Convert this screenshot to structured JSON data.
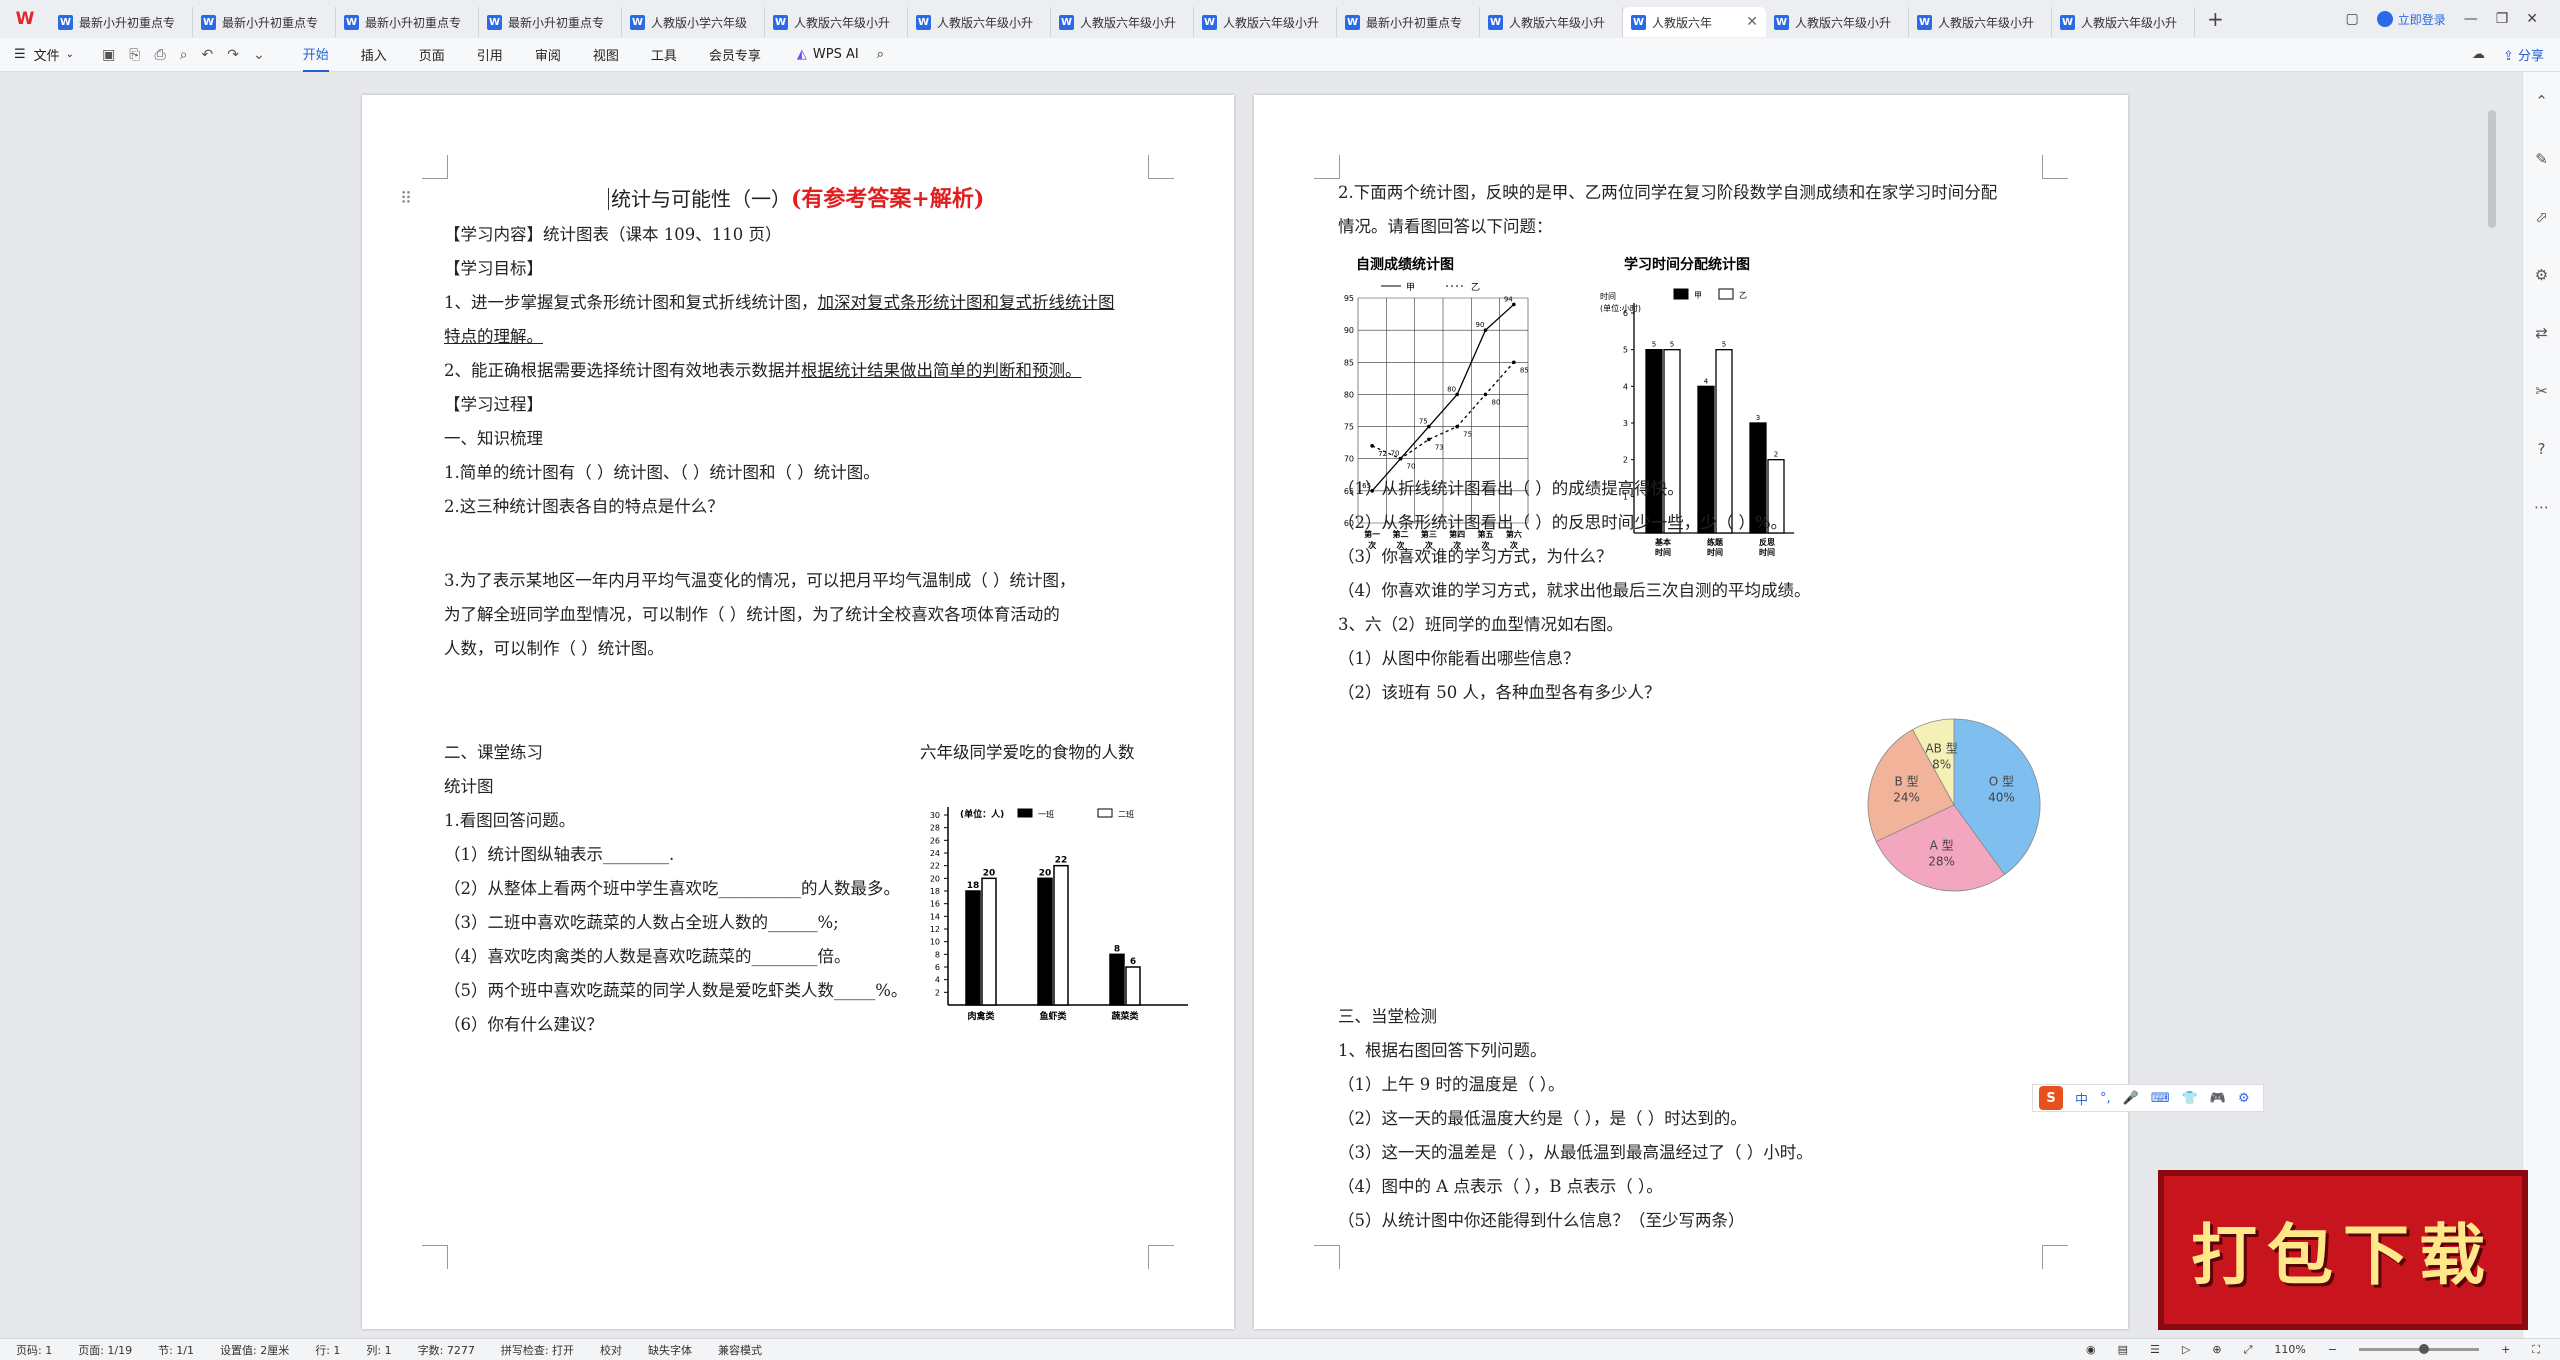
{
  "app": {
    "logo": "W"
  },
  "tabs": [
    "最新小升初重点专",
    "最新小升初重点专",
    "最新小升初重点专",
    "最新小升初重点专",
    "人教版小学六年级",
    "人教版六年级小升",
    "人教版六年级小升",
    "人教版六年级小升",
    "人教版六年级小升",
    "最新小升初重点专",
    "人教版六年级小升",
    "人教版六年",
    "人教版六年级小升",
    "人教版六年级小升",
    "人教版六年级小升"
  ],
  "title_bar": {
    "login": "立即登录",
    "share": "分享"
  },
  "toolbar": {
    "file": "文件",
    "menus": [
      "开始",
      "插入",
      "页面",
      "引用",
      "审阅",
      "视图",
      "工具",
      "会员专享"
    ],
    "wps_ai": "WPS AI"
  },
  "page1": {
    "title": "统计与可能性（一）",
    "title_red": "(有参考答案+解析)",
    "lines": [
      "【学习内容】统计图表（课本 109、110 页）",
      "【学习目标】",
      "1、进一步掌握复式条形统计图和复式折线统计图，",
      "加深对复式条形统计图和复式折线统计图",
      "特点的理解。",
      "2、能正确根据需要选择统计图有效地表示数据并",
      "根据统计结果做出简单的判断和预测。",
      "【学习过程】",
      "一、知识梳理",
      "1.简单的统计图有（    ）统计图、（    ）统计图和（    ）统计图。",
      "2.这三种统计图表各自的特点是什么？",
      "3.为了表示某地区一年内月平均气温变化的情况，可以把月平均气温制成（       ）统计图，",
      "为了解全班同学血型情况，可以制作（       ）统计图，为了统计全校喜欢各项体育活动的",
      "人数，可以制作（      ）统计图。",
      "二、课堂练习",
      "六年级同学爱吃的食物的人数",
      "统计图",
      "1.看图回答问题。",
      "（1）统计图纵轴表示________.",
      "（2）从整体上看两个班中学生喜欢吃__________的人数最多。",
      "（3）二班中喜欢吃蔬菜的人数占全班人数的______%;",
      "（4）喜欢吃肉禽类的人数是喜欢吃蔬菜的________倍。",
      "（5）两个班中喜欢吃蔬菜的同学人数是爱吃虾类人数_____%。",
      "（6）你有什么建议？"
    ]
  },
  "page2": {
    "lines": [
      "2.下面两个统计图，反映的是甲、乙两位同学在复习阶段数学自测成绩和在家学习时间分配",
      "情况。请看图回答以下问题：",
      "（1）从折线统计图看出（            ）的成绩提高得快。",
      "（2）从条形统计图看出（            ）的反思时间少一些，少（        ）%。",
      "（3）你喜欢谁的学习方式，为什么？",
      "（4）你喜欢谁的学习方式，就求出他最后三次自测的平均成绩。",
      "3、六（2）班同学的血型情况如右图。",
      "（1）从图中你能看出哪些信息？",
      "（2）该班有 50 人，各种血型各有多少人？",
      "三、当堂检测",
      "1、根据右图回答下列问题。",
      "（1）上午 9 时的温度是（     ）。",
      "（2）这一天的最低温度大约是（     ），是（     ）时达到的。",
      "（3）这一天的温差是（      ），从最低温到最高温经过了（      ）小时。",
      "（4）图中的 A 点表示（        ），B 点表示（        ）。",
      "（5）从统计图中你还能得到什么信息？（至少写两条）"
    ]
  },
  "chart_data": [
    {
      "type": "bar",
      "title": "",
      "ylabel": "(单位：人)",
      "categories": [
        "肉禽类",
        "鱼虾类",
        "蔬菜类"
      ],
      "series": [
        {
          "name": "一班",
          "values": [
            18,
            20,
            8
          ]
        },
        {
          "name": "二班",
          "values": [
            20,
            22,
            6
          ]
        }
      ],
      "ylim": [
        0,
        30
      ],
      "yticks": [
        2,
        4,
        6,
        8,
        10,
        12,
        14,
        16,
        18,
        20,
        22,
        24,
        26,
        28,
        30
      ]
    },
    {
      "type": "line",
      "title": "自测成绩统计图",
      "categories": [
        "第一次",
        "第二次",
        "第三次",
        "第四次",
        "第五次",
        "第六次"
      ],
      "series": [
        {
          "name": "甲",
          "values": [
            65,
            70,
            75,
            80,
            90,
            94
          ]
        },
        {
          "name": "乙",
          "values": [
            72,
            70,
            73,
            75,
            80,
            85
          ]
        }
      ],
      "ylim": [
        60,
        95
      ],
      "legend": [
        "甲",
        "乙"
      ]
    },
    {
      "type": "bar",
      "title": "学习时间分配统计图",
      "ylabel": "时间(单位:小时)",
      "categories": [
        "基本时间",
        "练题时间",
        "反思时间"
      ],
      "series": [
        {
          "name": "甲",
          "values": [
            5,
            4,
            3
          ]
        },
        {
          "name": "乙",
          "values": [
            5,
            5,
            2
          ]
        }
      ],
      "ylim": [
        0,
        6
      ]
    },
    {
      "type": "pie",
      "categories": [
        "O 型",
        "A 型",
        "B 型",
        "AB 型"
      ],
      "values": [
        40,
        28,
        24,
        8
      ],
      "labels": [
        "40%",
        "28%",
        "24%",
        "8%"
      ],
      "colors": [
        "#7fbfef",
        "#f2a7bf",
        "#f1b49a",
        "#f5f1b6"
      ]
    }
  ],
  "ime": {
    "label": "中"
  },
  "banner": {
    "text": "打包下载"
  },
  "status": {
    "items": [
      "页码: 1",
      "页面: 1/19",
      "节: 1/1",
      "设置值: 2厘米",
      "行: 1",
      "列: 1",
      "字数: 7277",
      "拼写检查: 打开",
      "校对",
      "缺失字体",
      "兼容模式"
    ],
    "zoom": "110%"
  }
}
